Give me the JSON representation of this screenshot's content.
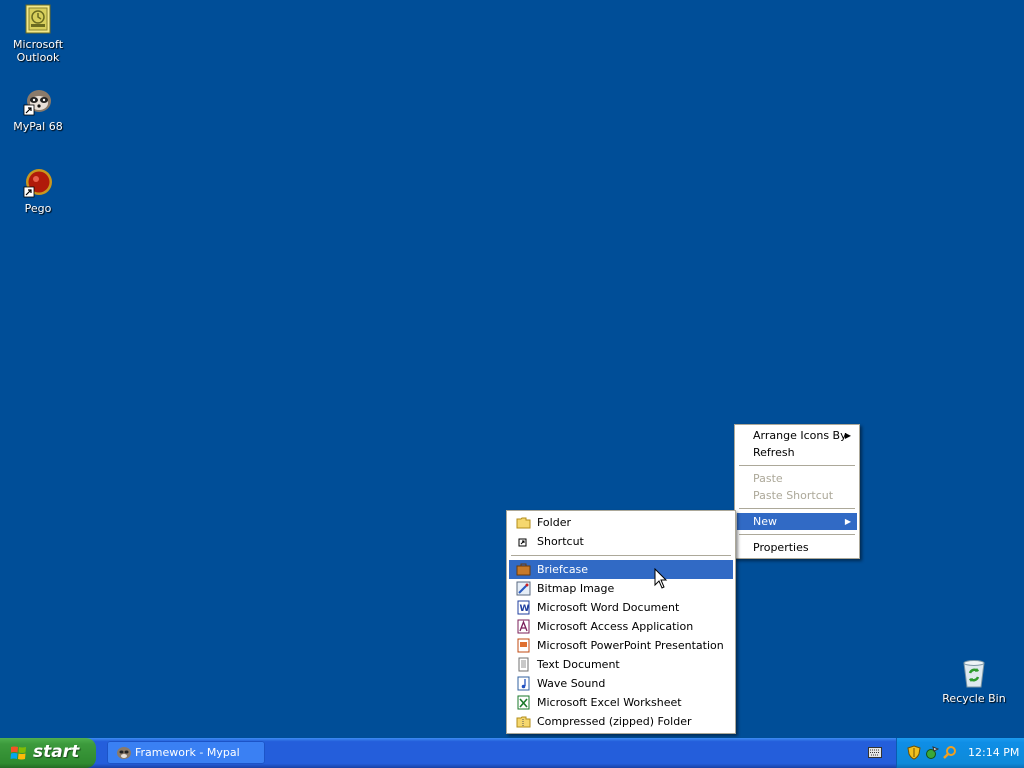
{
  "desktop": {
    "icons": [
      {
        "label_line1": "Microsoft",
        "label_line2": "Outlook",
        "icon": "outlook-icon"
      },
      {
        "label": "MyPal 68",
        "icon": "mypal-icon"
      },
      {
        "label": "Pego",
        "icon": "pego-icon"
      },
      {
        "label": "Recycle Bin",
        "icon": "recycle-bin-icon"
      }
    ]
  },
  "context_menu": {
    "items": [
      {
        "label": "Arrange Icons By",
        "submenu": true
      },
      {
        "label": "Refresh"
      },
      {
        "label": "Paste",
        "disabled": true
      },
      {
        "label": "Paste Shortcut",
        "disabled": true
      },
      {
        "label": "New",
        "submenu": true,
        "highlighted": true
      },
      {
        "label": "Properties"
      }
    ]
  },
  "new_submenu": {
    "items": [
      {
        "label": "Folder",
        "icon": "folder-icon"
      },
      {
        "label": "Shortcut",
        "icon": "shortcut-icon"
      },
      {
        "label": "Briefcase",
        "icon": "briefcase-icon",
        "highlighted": true
      },
      {
        "label": "Bitmap Image",
        "icon": "bitmap-icon"
      },
      {
        "label": "Microsoft Word Document",
        "icon": "word-icon"
      },
      {
        "label": "Microsoft Access Application",
        "icon": "access-icon"
      },
      {
        "label": "Microsoft PowerPoint Presentation",
        "icon": "powerpoint-icon"
      },
      {
        "label": "Text Document",
        "icon": "text-document-icon"
      },
      {
        "label": "Wave Sound",
        "icon": "wave-sound-icon"
      },
      {
        "label": "Microsoft Excel Worksheet",
        "icon": "excel-icon"
      },
      {
        "label": "Compressed (zipped) Folder",
        "icon": "zip-folder-icon"
      }
    ]
  },
  "taskbar": {
    "start_label": "start",
    "tasks": [
      {
        "label": "Framework - Mypal",
        "icon": "mypal-icon"
      }
    ],
    "clock": "12:14 PM",
    "tray_icons": [
      "security-shield-icon",
      "network-icon",
      "search-icon"
    ]
  },
  "colors": {
    "desktop": "#004e98",
    "menu_highlight": "#316ac5",
    "taskbar": "#245edb",
    "start_button": "#3c9a3c",
    "tray": "#0f8ee6"
  }
}
